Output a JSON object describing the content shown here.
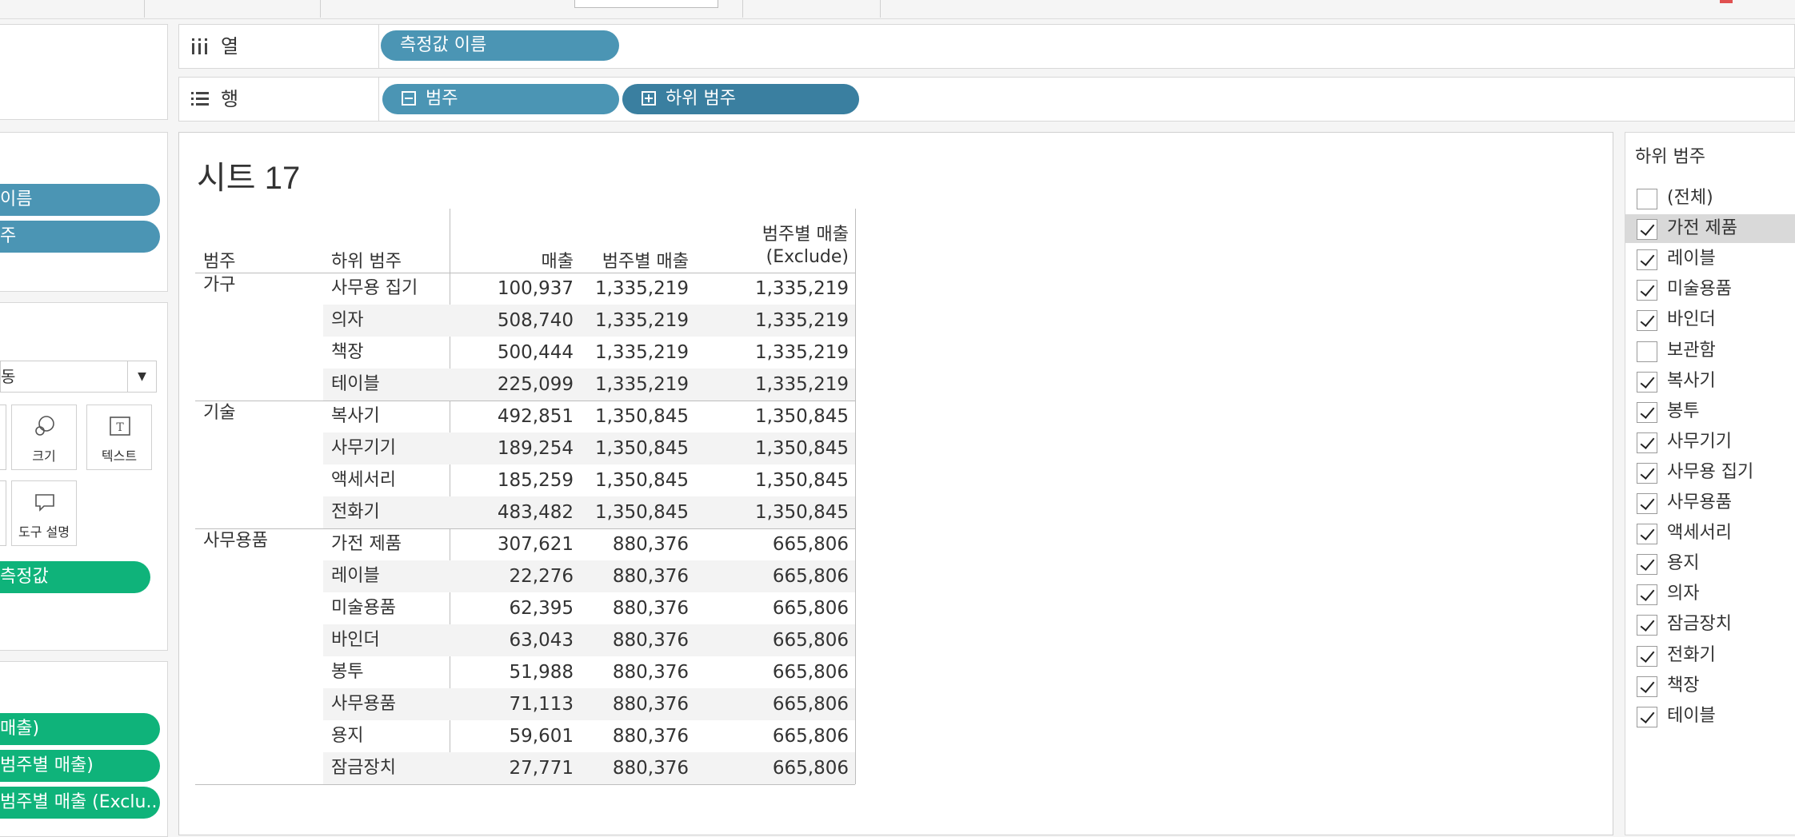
{
  "shelves": {
    "columns": {
      "label": "열",
      "pills": [
        "측정값 이름"
      ]
    },
    "rows": {
      "label": "행",
      "pills": [
        "범주",
        "하위 범주"
      ]
    }
  },
  "left_panel": {
    "measure_names_pills": [
      "이름",
      "주"
    ],
    "mark_type": "동",
    "marks_buttons": [
      "크기",
      "텍스트",
      "도구 설명"
    ],
    "measure_values_pill": "측정값",
    "measure_value_pills": [
      "매출)",
      "범주별 매출)",
      "범주별 매출 (Exclu.."
    ]
  },
  "sheet": {
    "title": "시트 17",
    "headers": {
      "category": "범주",
      "subcategory": "하위 범주",
      "sales": "매출",
      "sales_by_category": "범주별 매출",
      "sales_by_category_excl_1": "범주별 매출",
      "sales_by_category_excl_2": "(Exclude)"
    },
    "groups": [
      {
        "category": "가구",
        "rows": [
          {
            "sub": "사무용 집기",
            "sales": "100,937",
            "by_cat": "1,335,219",
            "by_cat_ex": "1,335,219"
          },
          {
            "sub": "의자",
            "sales": "508,740",
            "by_cat": "1,335,219",
            "by_cat_ex": "1,335,219"
          },
          {
            "sub": "책장",
            "sales": "500,444",
            "by_cat": "1,335,219",
            "by_cat_ex": "1,335,219"
          },
          {
            "sub": "테이블",
            "sales": "225,099",
            "by_cat": "1,335,219",
            "by_cat_ex": "1,335,219"
          }
        ]
      },
      {
        "category": "기술",
        "rows": [
          {
            "sub": "복사기",
            "sales": "492,851",
            "by_cat": "1,350,845",
            "by_cat_ex": "1,350,845"
          },
          {
            "sub": "사무기기",
            "sales": "189,254",
            "by_cat": "1,350,845",
            "by_cat_ex": "1,350,845"
          },
          {
            "sub": "액세서리",
            "sales": "185,259",
            "by_cat": "1,350,845",
            "by_cat_ex": "1,350,845"
          },
          {
            "sub": "전화기",
            "sales": "483,482",
            "by_cat": "1,350,845",
            "by_cat_ex": "1,350,845"
          }
        ]
      },
      {
        "category": "사무용품",
        "rows": [
          {
            "sub": "가전 제품",
            "sales": "307,621",
            "by_cat": "880,376",
            "by_cat_ex": "665,806"
          },
          {
            "sub": "레이블",
            "sales": "22,276",
            "by_cat": "880,376",
            "by_cat_ex": "665,806"
          },
          {
            "sub": "미술용품",
            "sales": "62,395",
            "by_cat": "880,376",
            "by_cat_ex": "665,806"
          },
          {
            "sub": "바인더",
            "sales": "63,043",
            "by_cat": "880,376",
            "by_cat_ex": "665,806"
          },
          {
            "sub": "봉투",
            "sales": "51,988",
            "by_cat": "880,376",
            "by_cat_ex": "665,806"
          },
          {
            "sub": "사무용품",
            "sales": "71,113",
            "by_cat": "880,376",
            "by_cat_ex": "665,806"
          },
          {
            "sub": "용지",
            "sales": "59,601",
            "by_cat": "880,376",
            "by_cat_ex": "665,806"
          },
          {
            "sub": "잠금장치",
            "sales": "27,771",
            "by_cat": "880,376",
            "by_cat_ex": "665,806"
          }
        ]
      }
    ]
  },
  "filter": {
    "title": "하위 범주",
    "items": [
      {
        "label": "(전체)",
        "checked": false,
        "selected": false
      },
      {
        "label": "가전 제품",
        "checked": true,
        "selected": true
      },
      {
        "label": "레이블",
        "checked": true,
        "selected": false
      },
      {
        "label": "미술용품",
        "checked": true,
        "selected": false
      },
      {
        "label": "바인더",
        "checked": true,
        "selected": false
      },
      {
        "label": "보관함",
        "checked": false,
        "selected": false
      },
      {
        "label": "복사기",
        "checked": true,
        "selected": false
      },
      {
        "label": "봉투",
        "checked": true,
        "selected": false
      },
      {
        "label": "사무기기",
        "checked": true,
        "selected": false
      },
      {
        "label": "사무용 집기",
        "checked": true,
        "selected": false
      },
      {
        "label": "사무용품",
        "checked": true,
        "selected": false
      },
      {
        "label": "액세서리",
        "checked": true,
        "selected": false
      },
      {
        "label": "용지",
        "checked": true,
        "selected": false
      },
      {
        "label": "의자",
        "checked": true,
        "selected": false
      },
      {
        "label": "잠금장치",
        "checked": true,
        "selected": false
      },
      {
        "label": "전화기",
        "checked": true,
        "selected": false
      },
      {
        "label": "책장",
        "checked": true,
        "selected": false
      },
      {
        "label": "테이블",
        "checked": true,
        "selected": false
      }
    ]
  },
  "colors": {
    "blue_pill": "#4b95b4",
    "blue_pill_dark": "#3a7fa0",
    "green_pill": "#0fb37a"
  }
}
